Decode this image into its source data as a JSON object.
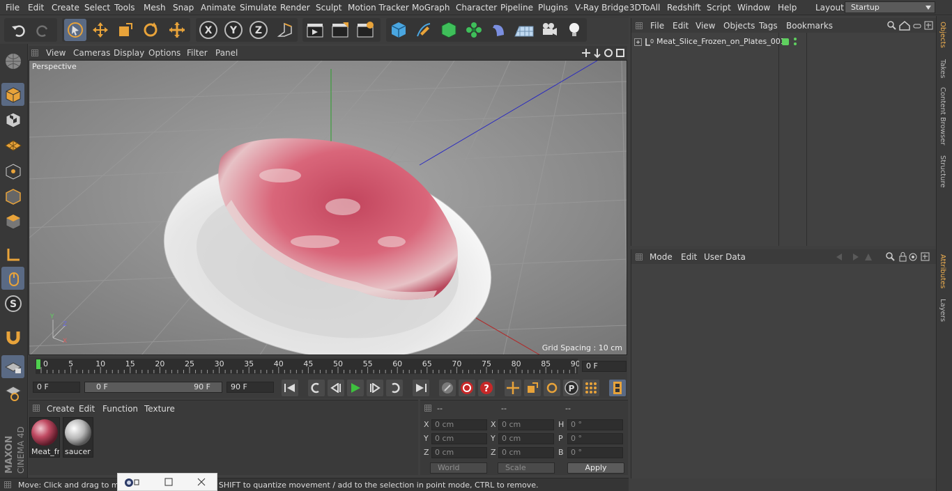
{
  "menubar": {
    "items": [
      "File",
      "Edit",
      "Create",
      "Select",
      "Tools",
      "Mesh",
      "Snap",
      "Animate",
      "Simulate",
      "Render",
      "Sculpt",
      "Motion Tracker",
      "MoGraph",
      "Character",
      "Pipeline",
      "Plugins",
      "V-Ray Bridge",
      "3DToAll",
      "Redshift",
      "Script",
      "Window",
      "Help"
    ],
    "layout_label": "Layout:",
    "layout_value": "Startup"
  },
  "viewport": {
    "menu": [
      "View",
      "Cameras",
      "Display",
      "Options",
      "Filter",
      "Panel"
    ],
    "label": "Perspective",
    "grid_spacing": "Grid Spacing : 10 cm"
  },
  "timeline": {
    "ticks": [
      "0",
      "5",
      "10",
      "15",
      "20",
      "25",
      "30",
      "35",
      "40",
      "45",
      "50",
      "55",
      "60",
      "65",
      "70",
      "75",
      "80",
      "85",
      "90"
    ],
    "current_frame": "0 F"
  },
  "transport": {
    "start_field": "0 F",
    "range_start": "0 F",
    "range_end": "90 F",
    "end_field": "90 F"
  },
  "materials": {
    "menu": [
      "Create",
      "Edit",
      "Function",
      "Texture"
    ],
    "items": [
      {
        "name": "Meat_fro",
        "type": "meat"
      },
      {
        "name": "saucer",
        "type": "saucer"
      }
    ]
  },
  "coords": {
    "headers": [
      "--",
      "--",
      "--"
    ],
    "rows": [
      {
        "a_label": "X",
        "a_value": "0 cm",
        "b_label": "X",
        "b_value": "0 cm",
        "c_label": "H",
        "c_value": "0 °"
      },
      {
        "a_label": "Y",
        "a_value": "0 cm",
        "b_label": "Y",
        "b_value": "0 cm",
        "c_label": "P",
        "c_value": "0 °"
      },
      {
        "a_label": "Z",
        "a_value": "0 cm",
        "b_label": "Z",
        "b_value": "0 cm",
        "c_label": "B",
        "c_value": "0 °"
      }
    ],
    "world": "World",
    "scale": "Scale",
    "apply": "Apply"
  },
  "status": {
    "text": "Move: Click and drag to move elements. Hold down SHIFT to quantize movement / add to the selection in point mode, CTRL to remove."
  },
  "objects": {
    "menu": [
      "File",
      "Edit",
      "View",
      "Objects",
      "Tags",
      "Bookmarks"
    ],
    "items": [
      {
        "name": "Meat_Slice_Frozen_on_Plates_001"
      }
    ]
  },
  "attributes": {
    "menu": [
      "Mode",
      "Edit",
      "User Data"
    ]
  },
  "right_tabs": [
    "Objects",
    "Takes",
    "Content Browser",
    "Structure",
    "Attributes",
    "Layers"
  ],
  "branding": {
    "line1": "MAXON",
    "line2": "CINEMA 4D"
  },
  "colors": {
    "accent": "#f0b050",
    "selection": "#5a6a84",
    "toolbar_icon": "#e8a33a"
  }
}
